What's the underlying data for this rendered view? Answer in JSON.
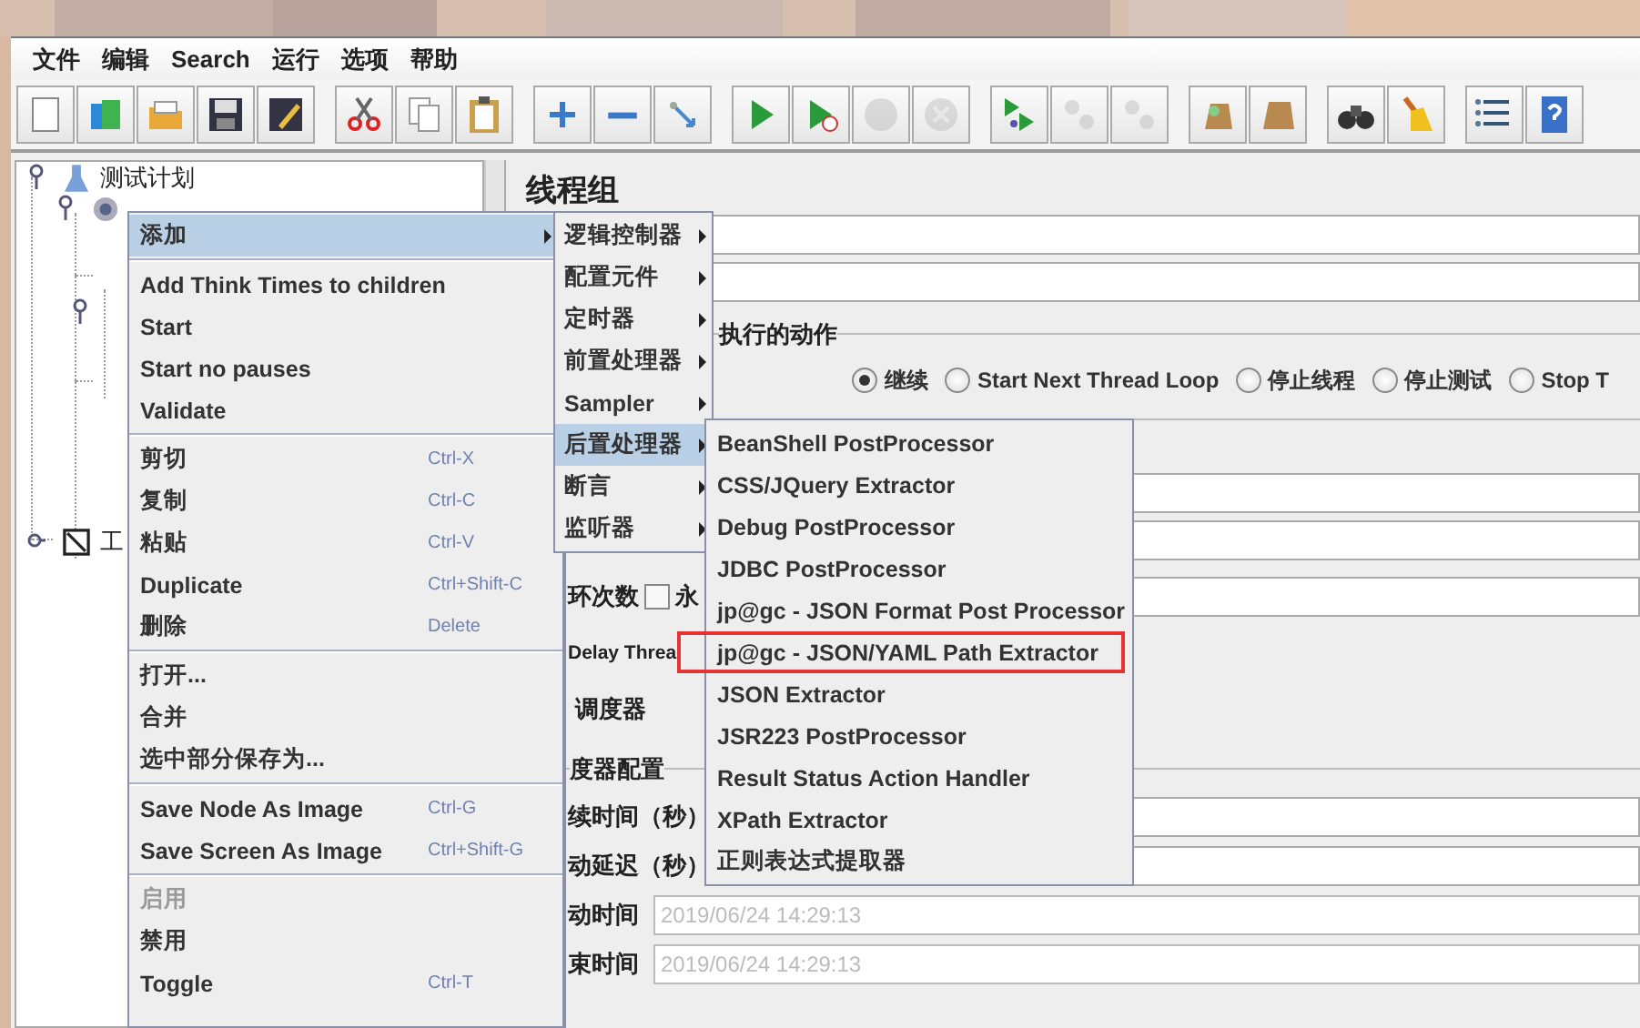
{
  "menu_bar": [
    "文件",
    "编辑",
    "Search",
    "运行",
    "选项",
    "帮助"
  ],
  "toolbar": [
    [
      {
        "kind": "new",
        "disabled": false
      },
      {
        "kind": "templates",
        "disabled": false
      },
      {
        "kind": "open",
        "disabled": false
      },
      {
        "kind": "save",
        "disabled": false
      },
      {
        "kind": "save-as",
        "disabled": false
      }
    ],
    [
      {
        "kind": "cut",
        "disabled": false
      },
      {
        "kind": "copy",
        "disabled": false
      },
      {
        "kind": "paste",
        "disabled": false
      }
    ],
    [
      {
        "kind": "expand",
        "disabled": false
      },
      {
        "kind": "collapse",
        "disabled": false
      },
      {
        "kind": "toggle",
        "disabled": false
      }
    ],
    [
      {
        "kind": "start",
        "disabled": false
      },
      {
        "kind": "start-no-pause",
        "disabled": false
      },
      {
        "kind": "stop",
        "disabled": true
      },
      {
        "kind": "shutdown",
        "disabled": true
      }
    ],
    [
      {
        "kind": "remote-start",
        "disabled": false
      },
      {
        "kind": "remote-stop",
        "disabled": true
      },
      {
        "kind": "remote-shutdown",
        "disabled": true
      }
    ],
    [
      {
        "kind": "clear",
        "disabled": false
      },
      {
        "kind": "clear-all",
        "disabled": false
      }
    ],
    [
      {
        "kind": "search",
        "disabled": false
      },
      {
        "kind": "reset",
        "disabled": false
      }
    ],
    [
      {
        "kind": "functions",
        "disabled": false
      },
      {
        "kind": "help",
        "disabled": false
      }
    ]
  ],
  "tree": [
    {
      "label": "测试计划",
      "kind": "plan",
      "expanded": true,
      "children": [
        {
          "kind": "thread-group",
          "expanded": true
        }
      ]
    },
    {
      "label": "工",
      "kind": "workbench",
      "expanded": false
    }
  ],
  "panel": {
    "title": "线程组",
    "action_legend": "执行的动作",
    "actions": [
      {
        "label": "继续",
        "selected": true
      },
      {
        "label": "Start Next Thread Loop",
        "selected": false
      },
      {
        "label": "停止线程",
        "selected": false
      },
      {
        "label": "停止测试",
        "selected": false
      },
      {
        "label": "Stop T",
        "selected": false
      }
    ],
    "loop_label": "环次数",
    "forever_checked": false,
    "forever_label": "永",
    "delay_label": "Delay Threa",
    "scheduler_label": "调度器",
    "scheduler_legend": "度器配置",
    "schedule_rows": [
      {
        "label": "续时间（秒）"
      },
      {
        "label": "动延迟（秒）"
      },
      {
        "label": "动时间",
        "value": "2019/06/24 14:29:13"
      },
      {
        "label": "束时间",
        "value": "2019/06/24 14:29:13"
      }
    ]
  },
  "context_menu": [
    [
      {
        "label": "添加",
        "submenu": true,
        "selected": true
      }
    ],
    [
      {
        "label": "Add Think Times to children"
      },
      {
        "label": "Start"
      },
      {
        "label": "Start no pauses"
      },
      {
        "label": "Validate"
      }
    ],
    [
      {
        "label": "剪切",
        "shortcut": "Ctrl-X"
      },
      {
        "label": "复制",
        "shortcut": "Ctrl-C"
      },
      {
        "label": "粘贴",
        "shortcut": "Ctrl-V"
      },
      {
        "label": "Duplicate",
        "shortcut": "Ctrl+Shift-C"
      },
      {
        "label": "删除",
        "shortcut": "Delete"
      }
    ],
    [
      {
        "label": "打开..."
      },
      {
        "label": "合并"
      },
      {
        "label": "选中部分保存为..."
      }
    ],
    [
      {
        "label": "Save Node As Image",
        "shortcut": "Ctrl-G"
      },
      {
        "label": "Save Screen As Image",
        "shortcut": "Ctrl+Shift-G"
      }
    ],
    [
      {
        "label": "启用",
        "disabled": true
      },
      {
        "label": "禁用"
      },
      {
        "label": "Toggle",
        "shortcut": "Ctrl-T"
      }
    ]
  ],
  "add_menu": [
    {
      "label": "逻辑控制器",
      "selected": false
    },
    {
      "label": "配置元件",
      "selected": false
    },
    {
      "label": "定时器",
      "selected": false
    },
    {
      "label": "前置处理器",
      "selected": false
    },
    {
      "label": "Sampler",
      "selected": false
    },
    {
      "label": "后置处理器",
      "selected": true
    },
    {
      "label": "断言",
      "selected": false
    },
    {
      "label": "监听器",
      "selected": false
    }
  ],
  "post_processor_menu": [
    {
      "label": "BeanShell PostProcessor",
      "highlighted": false
    },
    {
      "label": "CSS/JQuery Extractor",
      "highlighted": false
    },
    {
      "label": "Debug PostProcessor",
      "highlighted": false
    },
    {
      "label": "JDBC PostProcessor",
      "highlighted": false
    },
    {
      "label": "jp@gc - JSON Format Post Processor",
      "highlighted": false
    },
    {
      "label": "jp@gc - JSON/YAML Path Extractor",
      "highlighted": true
    },
    {
      "label": "JSON Extractor",
      "highlighted": false
    },
    {
      "label": "JSR223 PostProcessor",
      "highlighted": false
    },
    {
      "label": "Result Status Action Handler",
      "highlighted": false
    },
    {
      "label": "XPath Extractor",
      "highlighted": false
    },
    {
      "label": "正则表达式提取器",
      "highlighted": false
    }
  ]
}
